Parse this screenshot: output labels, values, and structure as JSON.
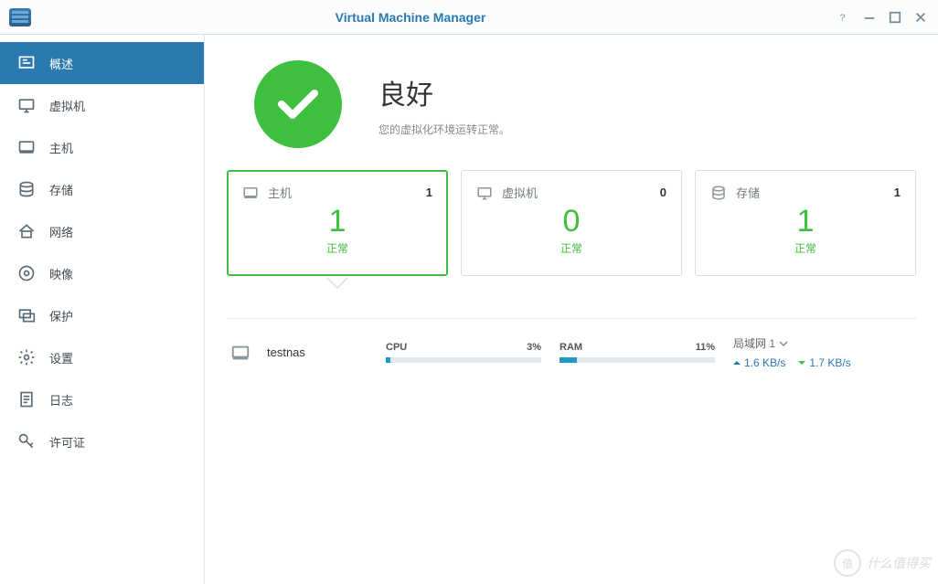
{
  "titlebar": {
    "title": "Virtual Machine Manager"
  },
  "sidebar": {
    "items": [
      {
        "label": "概述"
      },
      {
        "label": "虚拟机"
      },
      {
        "label": "主机"
      },
      {
        "label": "存储"
      },
      {
        "label": "网络"
      },
      {
        "label": "映像"
      },
      {
        "label": "保护"
      },
      {
        "label": "设置"
      },
      {
        "label": "日志"
      },
      {
        "label": "许可证"
      }
    ],
    "active_index": 0
  },
  "status": {
    "title": "良好",
    "subtitle": "您的虚拟化环境运转正常。"
  },
  "cards": [
    {
      "label": "主机",
      "count": "1",
      "value": "1",
      "status": "正常"
    },
    {
      "label": "虚拟机",
      "count": "0",
      "value": "0",
      "status": "正常"
    },
    {
      "label": "存储",
      "count": "1",
      "value": "1",
      "status": "正常"
    }
  ],
  "host": {
    "name": "testnas",
    "cpu_label": "CPU",
    "cpu_pct": "3%",
    "cpu_fill": 3,
    "ram_label": "RAM",
    "ram_pct": "11%",
    "ram_fill": 11,
    "net_label": "局域网 1",
    "up": "1.6 KB/s",
    "down": "1.7 KB/s"
  },
  "watermark": {
    "badge": "值",
    "text": "什么值得买"
  }
}
